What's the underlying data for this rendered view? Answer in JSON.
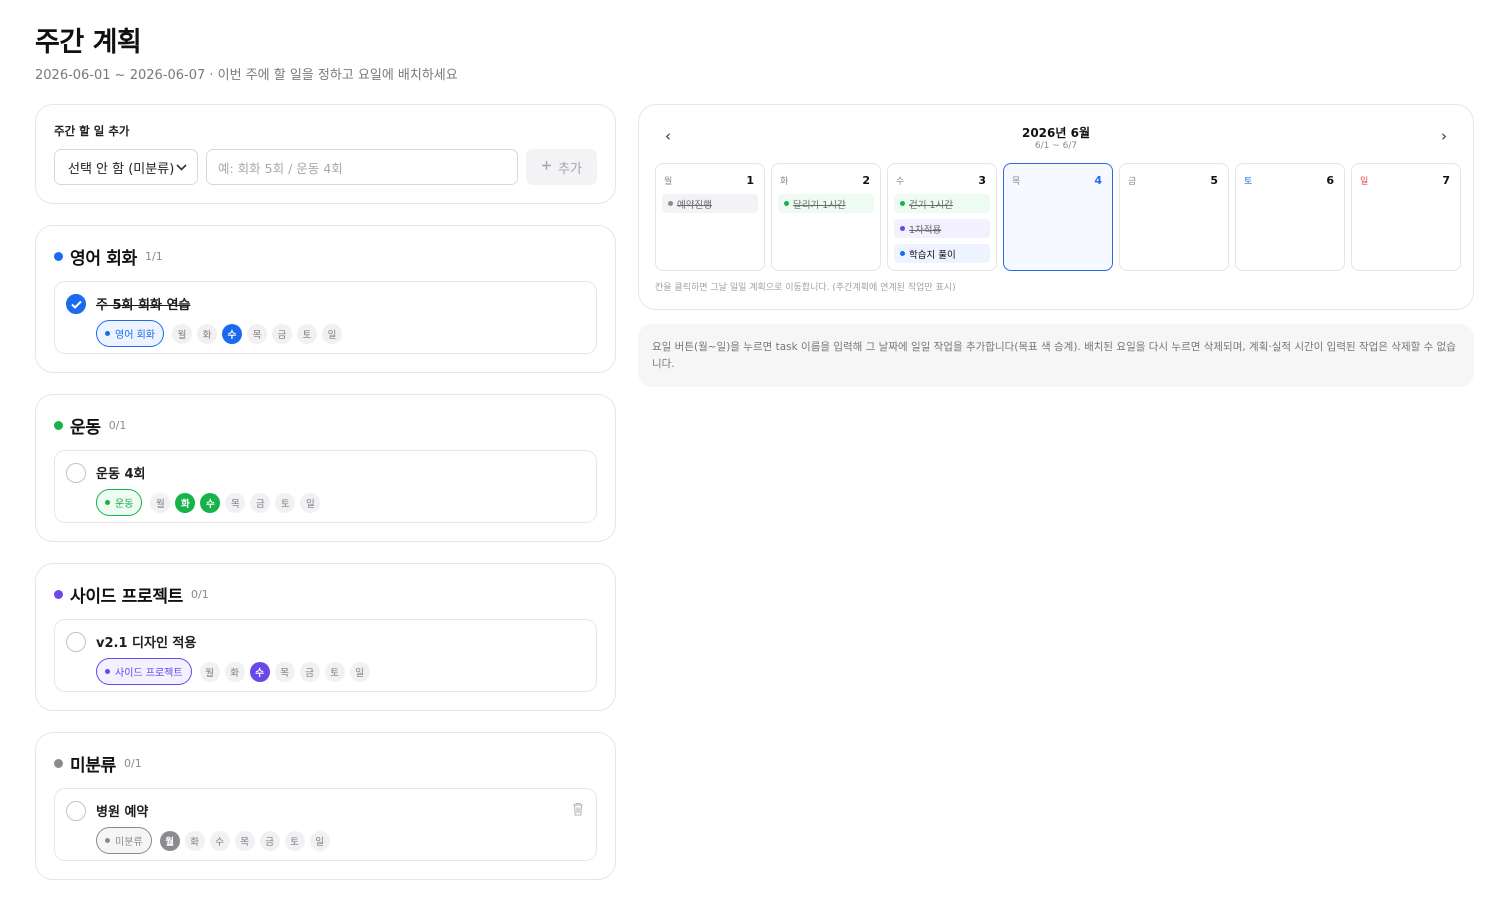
{
  "header": {
    "title": "주간 계획",
    "subtitle": "2026-06-01 ~ 2026-06-07 · 이번 주에 할 일을 정하고 요일에 배치하세요"
  },
  "add_task": {
    "label": "주간 할 일 추가",
    "select_value": "선택 안 함 (미분류)",
    "input_placeholder": "예: 회화 5회 / 운동 4회",
    "button_label": "추가"
  },
  "weekday_labels": [
    "월",
    "화",
    "수",
    "목",
    "금",
    "토",
    "일"
  ],
  "goals": [
    {
      "name": "영어 회화",
      "count": "1/1",
      "color": "#1a6bf0",
      "tag_bg": "#eef4ff",
      "task": {
        "name": "주 5회 회화 연습",
        "done": true,
        "active_days": [
          "수"
        ]
      }
    },
    {
      "name": "운동",
      "count": "0/1",
      "color": "#16b24a",
      "tag_bg": "#edfbf2",
      "task": {
        "name": "운동 4회",
        "done": false,
        "active_days": [
          "화",
          "수"
        ]
      }
    },
    {
      "name": "사이드 프로젝트",
      "count": "0/1",
      "color": "#6b46e8",
      "tag_bg": "#f3f0ff",
      "task": {
        "name": "v2.1 디자인 적용",
        "done": false,
        "active_days": [
          "수"
        ]
      }
    },
    {
      "name": "미분류",
      "count": "0/1",
      "color": "#8a8a90",
      "tag_bg": "#f5f5f6",
      "task": {
        "name": "병원 예약",
        "done": false,
        "active_days": [
          "월"
        ],
        "deletable": true
      }
    }
  ],
  "calendar": {
    "prev_icon": "‹",
    "next_icon": "›",
    "title": "2026년 6월",
    "range": "6/1 ~ 6/7",
    "days": [
      {
        "name": "월",
        "date": "1",
        "name_color": "#8a8a8f",
        "date_color": "#111111",
        "today": false,
        "tasks": [
          {
            "text": "예약진행",
            "color": "#8a8a90",
            "bg": "#f3f3f5",
            "done": true
          }
        ]
      },
      {
        "name": "화",
        "date": "2",
        "name_color": "#8a8a8f",
        "date_color": "#111111",
        "today": false,
        "tasks": [
          {
            "text": "달리기 1시간",
            "color": "#16b24a",
            "bg": "#edfbf2",
            "done": true
          }
        ]
      },
      {
        "name": "수",
        "date": "3",
        "name_color": "#8a8a8f",
        "date_color": "#111111",
        "today": false,
        "tasks": [
          {
            "text": "걷기 1시간",
            "color": "#16b24a",
            "bg": "#edfbf2",
            "done": true
          },
          {
            "text": "1차적용",
            "color": "#6b46e8",
            "bg": "#f3f0ff",
            "done": true
          },
          {
            "text": "학습지 풀이",
            "color": "#1a6bf0",
            "bg": "#eef4ff",
            "done": false
          }
        ]
      },
      {
        "name": "목",
        "date": "4",
        "name_color": "#8a8a8f",
        "date_color": "#2a6ae8",
        "today": true,
        "tasks": []
      },
      {
        "name": "금",
        "date": "5",
        "name_color": "#8a8a8f",
        "date_color": "#111111",
        "today": false,
        "tasks": []
      },
      {
        "name": "토",
        "date": "6",
        "name_color": "#2a6ae8",
        "date_color": "#111111",
        "today": false,
        "tasks": []
      },
      {
        "name": "일",
        "date": "7",
        "name_color": "#e5484d",
        "date_color": "#111111",
        "today": false,
        "tasks": []
      }
    ],
    "hint": "칸을 클릭하면 그날 일일 계획으로 이동합니다. (주간계획에 연계된 작업만 표시)"
  },
  "info_text": "요일 버튼(월~일)을 누르면 task 이름을 입력해 그 날짜에 일일 작업을 추가합니다(목표 색 승계). 배치된 요일을 다시 누르면 삭제되며, 계획·실적 시간이 입력된 작업은 삭제할 수 없습니다."
}
